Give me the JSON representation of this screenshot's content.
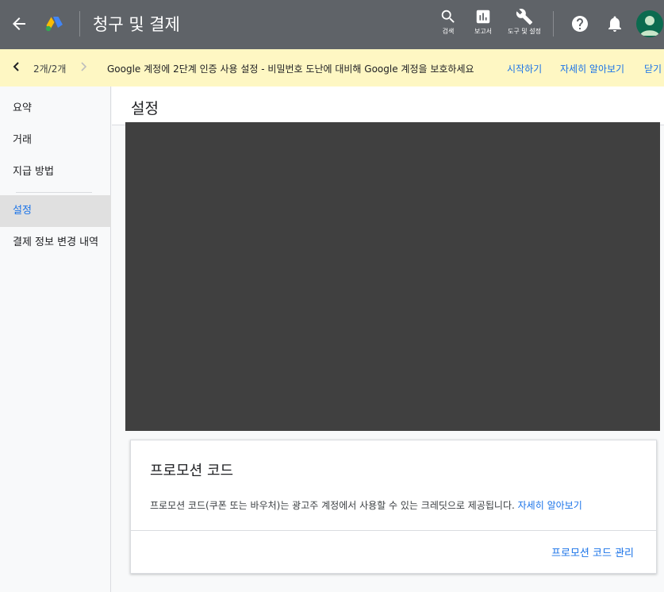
{
  "header": {
    "title": "청구 및 결제",
    "tools": [
      {
        "label": "검색",
        "icon": "search-icon"
      },
      {
        "label": "보고서",
        "icon": "reports-icon"
      },
      {
        "label": "도구 및 설정",
        "icon": "wrench-icon"
      }
    ],
    "colors": {
      "bar": "#5f6368"
    }
  },
  "banner": {
    "count": "2개/2개",
    "message": "Google 계정에 2단계 인증 사용 설정 - 비밀번호 도난에 대비해 Google 계정을 보호하세요",
    "actions": [
      "시작하기",
      "자세히 알아보기",
      "닫기"
    ]
  },
  "sidebar": {
    "items": [
      {
        "label": "요약"
      },
      {
        "label": "거래"
      },
      {
        "label": "지급 방법"
      },
      {
        "label": "설정"
      },
      {
        "label": "결제 정보 변경 내역"
      }
    ],
    "active_index": 3
  },
  "main": {
    "page_title": "설정",
    "promo_card": {
      "title": "프로모션 코드",
      "description": "프로모션 코드(쿠폰 또는 바우처)는 광고주 계정에서 사용할 수 있는 크레딧으로 제공됩니다.",
      "learn_more": "자세히 알아보기",
      "action": "프로모션 코드 관리"
    }
  }
}
